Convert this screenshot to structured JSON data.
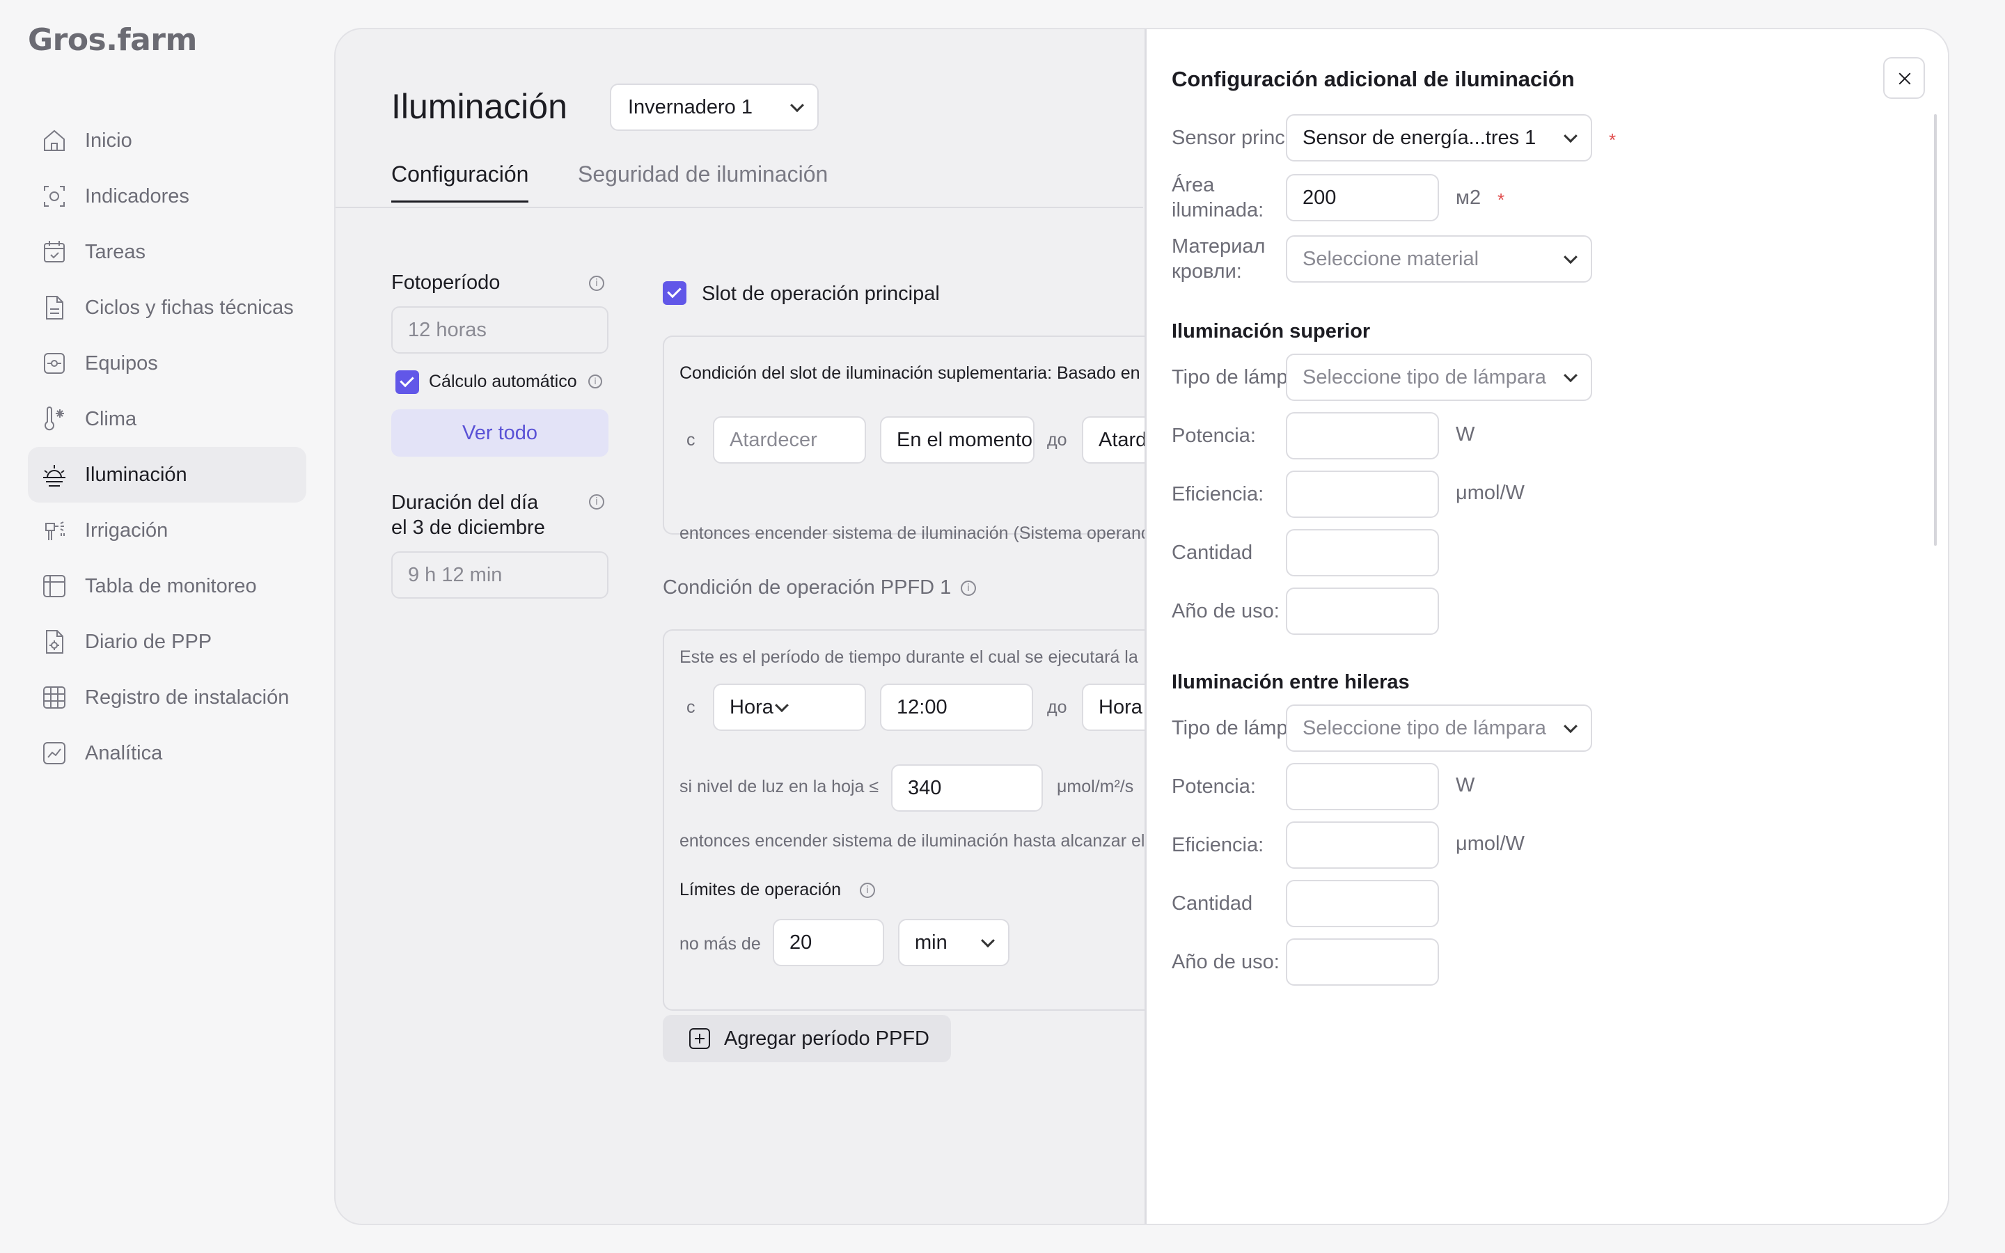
{
  "app": {
    "logo": "Gros.farm"
  },
  "sidebar": {
    "items": [
      {
        "label": "Inicio",
        "icon": "home-icon"
      },
      {
        "label": "Indicadores",
        "icon": "indicators-icon"
      },
      {
        "label": "Tareas",
        "icon": "tasks-icon"
      },
      {
        "label": "Ciclos y fichas técnicas",
        "icon": "document-icon"
      },
      {
        "label": "Equipos",
        "icon": "equipment-icon"
      },
      {
        "label": "Clima",
        "icon": "climate-icon"
      },
      {
        "label": "Iluminación",
        "icon": "sunrise-icon",
        "active": true
      },
      {
        "label": "Irrigación",
        "icon": "irrigation-icon"
      },
      {
        "label": "Tabla de monitoreo",
        "icon": "table-icon"
      },
      {
        "label": "Diario de PPP",
        "icon": "journal-icon"
      },
      {
        "label": "Registro de instalación",
        "icon": "grid-icon"
      },
      {
        "label": "Analítica",
        "icon": "analytics-icon"
      }
    ]
  },
  "main": {
    "title": "Iluminación",
    "greenhouse": "Invernadero 1",
    "tabs": [
      "Configuración",
      "Seguridad de iluminación"
    ],
    "photoperiod": {
      "label": "Fotoperíodo",
      "value": "12 horas",
      "auto_calc": "Cálculo automático",
      "view_all": "Ver todo"
    },
    "day_length": {
      "label_line1": "Duración del día",
      "label_line2": "el 3 de diciembre",
      "value": "9 h 12 min"
    },
    "main_slot": {
      "label": "Slot de operación principal",
      "condition": "Condición del slot de iluminación suplementaria: Basado en",
      "from": "с",
      "from_value": "Atardecer",
      "moment": "En el momento",
      "to": "до",
      "to_value": "Atardecer",
      "then": "entonces encender sistema de iluminación (Sistema operando)"
    },
    "ppfd": {
      "label": "Condición de operación PPFD 1",
      "desc": "Este es el período de tiempo durante el cual se ejecutará la",
      "from": "с",
      "from_type": "Hora",
      "from_time": "12:00",
      "to": "до",
      "to_type": "Hora",
      "if_label": "si nivel de luz en la hoja ≤",
      "light_value": "340",
      "light_unit": "μmol/m²/s",
      "then": "entonces encender sistema de iluminación hasta alcanzar el",
      "limits_label": "Límites de operación",
      "no_more": "no más de",
      "limit_value": "20",
      "limit_unit": "min"
    },
    "add_button": "Agregar período PPFD"
  },
  "panel": {
    "title": "Configuración adicional de iluminación",
    "sensor_label": "Sensor principal:",
    "sensor_value": "Sensor de energía...tres 1",
    "area_label_1": "Área",
    "area_label_2": "iluminada:",
    "area_value": "200",
    "area_unit": "м2",
    "material_label_1": "Материал",
    "material_label_2": "кровли:",
    "material_placeholder": "Seleccione material",
    "top": {
      "title": "Iluminación superior",
      "lamp_label": "Tipo de lámpara:",
      "lamp_placeholder": "Seleccione tipo de lámpara",
      "power_label": "Potencia:",
      "power_unit": "W",
      "eff_label": "Eficiencia:",
      "eff_unit": "μmol/W",
      "qty_label": "Cantidad",
      "year_label": "Año de uso:"
    },
    "inter": {
      "title": "Iluminación entre hileras",
      "lamp_label": "Tipo de lámpara:",
      "lamp_placeholder": "Seleccione tipo de lámpara",
      "power_label": "Potencia:",
      "power_unit": "W",
      "eff_label": "Eficiencia:",
      "eff_unit": "μmol/W",
      "qty_label": "Cantidad",
      "year_label": "Año de uso:"
    },
    "required_mark": "*"
  },
  "colors": {
    "accent": "#6157e8",
    "required": "#e04b4b",
    "active_bg": "#ebebee"
  }
}
